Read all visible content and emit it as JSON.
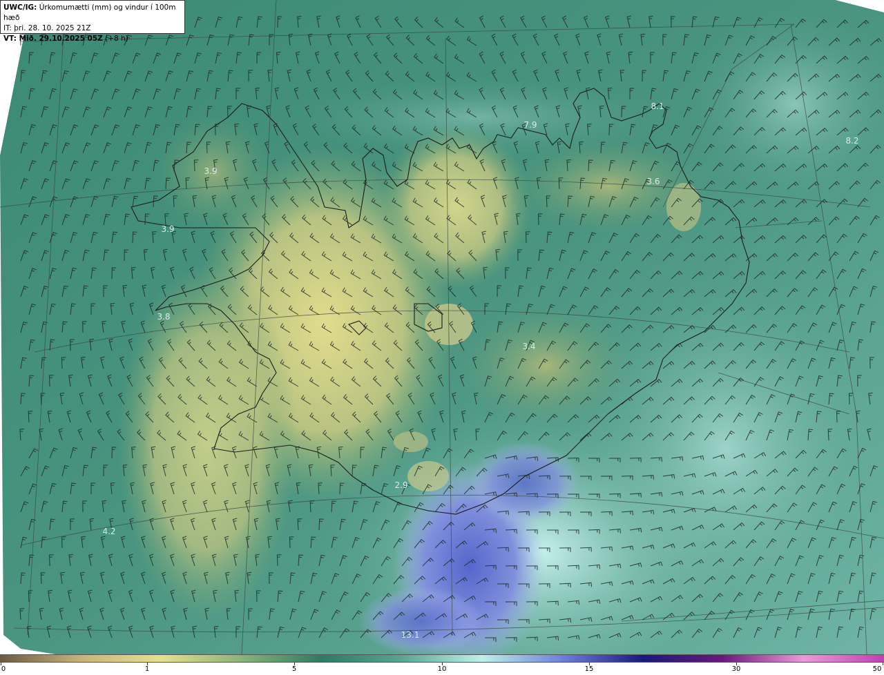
{
  "title": {
    "model": "UWC/IG:",
    "description": "Úrkomumætti (mm) og vindur í 100m hæð",
    "init_time": "IT: þri. 28. 10. 2025 21Z",
    "valid_prefix": "VT: Mið. 29.10.2025 05Z",
    "valid_suffix": "(+8 h)"
  },
  "labels": [
    {
      "id": "label-3-9-a",
      "text": "3.9"
    },
    {
      "id": "label-3-9-b",
      "text": "3.9"
    },
    {
      "id": "label-3-8",
      "text": "3.8"
    },
    {
      "id": "label-4-2",
      "text": "4.2"
    },
    {
      "id": "label-2-9",
      "text": "2.9"
    },
    {
      "id": "label-13-1",
      "text": "13.1"
    },
    {
      "id": "label-3-4",
      "text": "3.4"
    },
    {
      "id": "label-3-6",
      "text": "3.6"
    },
    {
      "id": "label-7-9",
      "text": "7.9"
    },
    {
      "id": "label-8-1",
      "text": "8.1"
    },
    {
      "id": "label-8-2",
      "text": "8.2"
    }
  ],
  "colorbar": {
    "ticks": [
      "0",
      "1",
      "5",
      "10",
      "15",
      "30",
      "50"
    ],
    "colors": [
      "#6b5a44",
      "#c8b27a",
      "#e6e08a",
      "#8cb27a",
      "#2f7a62",
      "#5aa593",
      "#bff0ea",
      "#6f7fd8",
      "#1a1a7a",
      "#6a1a7a",
      "#ea9ad8",
      "#c040b0"
    ]
  }
}
